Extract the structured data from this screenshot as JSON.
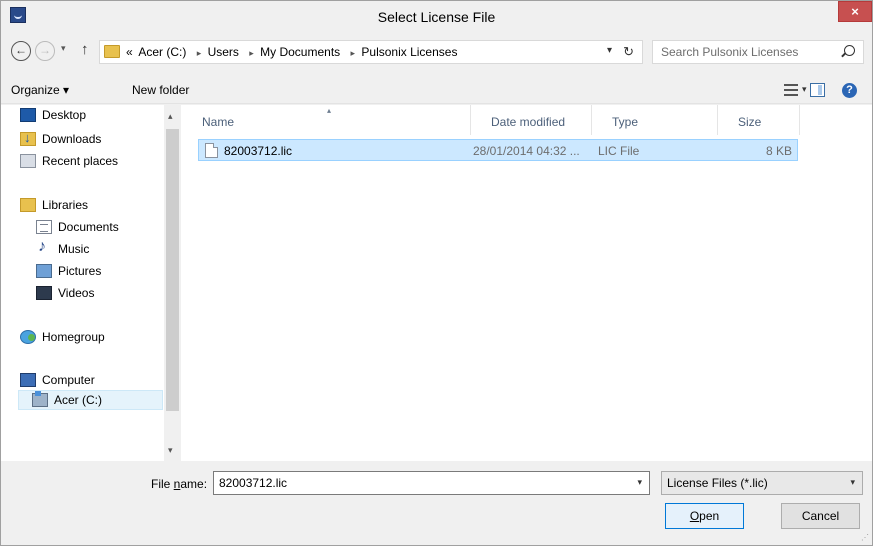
{
  "window": {
    "title": "Select License File",
    "close_label": "×"
  },
  "nav": {
    "back": "←",
    "forward": "→",
    "recent": "▾",
    "up": "↑",
    "breadcrumb": [
      "«",
      "Acer (C:)",
      "Users",
      "My Documents",
      "Pulsonix Licenses"
    ],
    "separator": "▸",
    "address_dropdown": "▾",
    "refresh": "↻",
    "search_placeholder": "Search Pulsonix Licenses"
  },
  "toolbar": {
    "organize_label": "Organize ▾",
    "new_folder_label": "New folder",
    "view_dropdown": "▾",
    "help_label": "?"
  },
  "sidebar": {
    "items": [
      {
        "label": "Desktop",
        "icon": "desktop-icon"
      },
      {
        "label": "Downloads",
        "icon": "downloads-icon"
      },
      {
        "label": "Recent places",
        "icon": "recent-places-icon"
      },
      {
        "label": "Libraries",
        "icon": "libraries-icon"
      },
      {
        "label": "Documents",
        "icon": "documents-icon"
      },
      {
        "label": "Music",
        "icon": "music-icon"
      },
      {
        "label": "Pictures",
        "icon": "pictures-icon"
      },
      {
        "label": "Videos",
        "icon": "videos-icon"
      },
      {
        "label": "Homegroup",
        "icon": "homegroup-icon"
      },
      {
        "label": "Computer",
        "icon": "computer-icon"
      },
      {
        "label": "Acer (C:)",
        "icon": "drive-icon",
        "selected": true
      }
    ],
    "scroll_up": "▴",
    "scroll_down": "▾"
  },
  "filelist": {
    "columns": [
      "Name",
      "Date modified",
      "Type",
      "Size"
    ],
    "sort_indicator": "▴",
    "rows": [
      {
        "name": "82003712.lic",
        "date": "28/01/2014 04:32 ...",
        "type": "LIC File",
        "size": "8 KB"
      }
    ]
  },
  "bottom": {
    "file_name_label_pre": "File ",
    "file_name_label_accel": "n",
    "file_name_label_post": "ame:",
    "file_name_value": "82003712.lic",
    "dropdown_arrow": "▾",
    "file_type_value": "License Files (*.lic)",
    "open_accel": "O",
    "open_rest": "pen",
    "cancel_label": "Cancel",
    "grip": "⋰"
  },
  "colors": {
    "selection": "#cce8ff",
    "selection_border": "#99d1ff",
    "close": "#c75050",
    "header_text": "#4c607a"
  }
}
